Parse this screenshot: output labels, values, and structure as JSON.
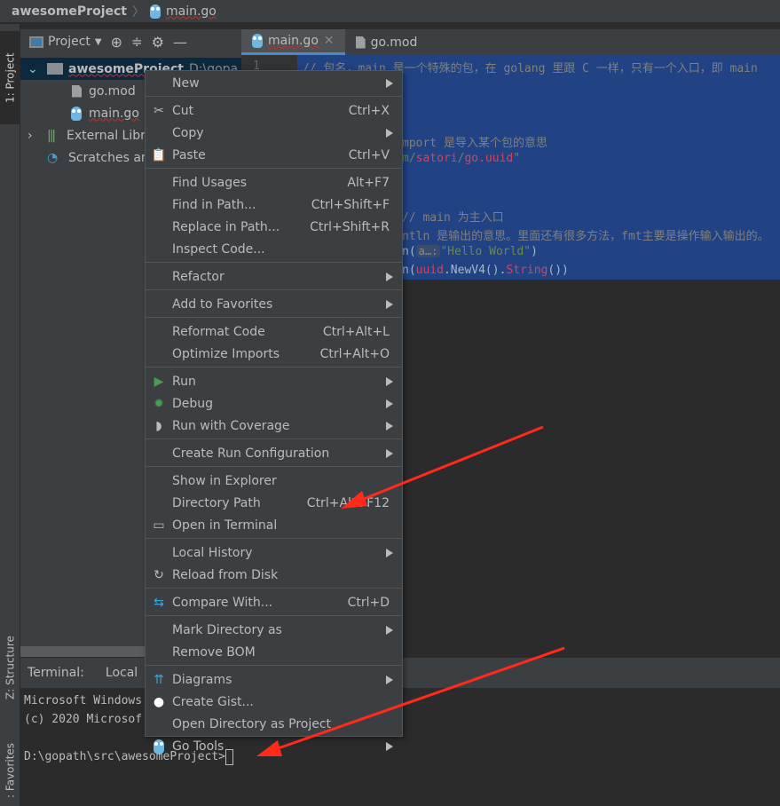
{
  "titlebar": {
    "project": "awesomeProject",
    "file": "main.go"
  },
  "leftstrip": {
    "project_tab": "1: Project",
    "structure_tab": "Z: Structure",
    "favorites_tab": ": Favorites"
  },
  "project_toolbar": {
    "view_label": "Project"
  },
  "tree": [
    {
      "label": "awesomeProject",
      "path": "D:\\gopa",
      "icon": "folder-icon",
      "expanded": true
    },
    {
      "label": "go.mod",
      "icon": "file-icon"
    },
    {
      "label": "main.go",
      "icon": "gopher-icon"
    },
    {
      "label": "External Libr",
      "icon": "library-icon"
    },
    {
      "label": "Scratches ar",
      "icon": "scratches-icon"
    }
  ],
  "editor_tabs": [
    {
      "label": "main.go",
      "active": true
    },
    {
      "label": "go.mod",
      "active": false
    }
  ],
  "code": {
    "line_number": "1",
    "line1": "// 包名，main 是一个特殊的包，在 golang 里跟 C 一样，只有一个入口，即 main",
    "line5": "mport 是导入某个包的意思",
    "line6_a": "m/",
    "line6_b": "satori",
    "line6_c": "/",
    "line6_d": "go.uuid",
    "line6_e": "\"",
    "line9": "// main 为主入口",
    "line10": "ntln 是输出的意思。里面还有很多方法，fmt主要是操作输入输出的。",
    "line11_a": "n(",
    "line11_hint": "a…:",
    "line11_b": "\"Hello World\"",
    "line11_c": ")",
    "line12_a": "n(",
    "line12_b": "uuid",
    "line12_c": ".NewV4().",
    "line12_d": "String",
    "line12_e": "())"
  },
  "terminal": {
    "label": "Terminal:",
    "tab": "Local",
    "lines": [
      "Microsoft Windows",
      "(c) 2020 Microsof",
      "",
      "D:\\gopath\\src\\awesomeProject>"
    ]
  },
  "context_menu": [
    {
      "label": "New",
      "submenu": true
    },
    {
      "sep": true
    },
    {
      "label": "Cut",
      "shortcut": "Ctrl+X",
      "icon": "scissors-icon"
    },
    {
      "label": "Copy",
      "submenu": true
    },
    {
      "label": "Paste",
      "shortcut": "Ctrl+V",
      "icon": "clipboard-icon"
    },
    {
      "sep": true
    },
    {
      "label": "Find Usages",
      "shortcut": "Alt+F7"
    },
    {
      "label": "Find in Path...",
      "shortcut": "Ctrl+Shift+F"
    },
    {
      "label": "Replace in Path...",
      "shortcut": "Ctrl+Shift+R"
    },
    {
      "label": "Inspect Code..."
    },
    {
      "sep": true
    },
    {
      "label": "Refactor",
      "submenu": true
    },
    {
      "sep": true
    },
    {
      "label": "Add to Favorites",
      "submenu": true
    },
    {
      "sep": true
    },
    {
      "label": "Reformat Code",
      "shortcut": "Ctrl+Alt+L"
    },
    {
      "label": "Optimize Imports",
      "shortcut": "Ctrl+Alt+O"
    },
    {
      "sep": true
    },
    {
      "label": "Run",
      "submenu": true,
      "icon": "run-icon"
    },
    {
      "label": "Debug",
      "submenu": true,
      "icon": "debug-icon"
    },
    {
      "label": "Run with Coverage",
      "submenu": true,
      "icon": "coverage-icon"
    },
    {
      "sep": true
    },
    {
      "label": "Create Run Configuration",
      "submenu": true
    },
    {
      "sep": true
    },
    {
      "label": "Show in Explorer"
    },
    {
      "label": "Directory Path",
      "shortcut": "Ctrl+Alt+F12"
    },
    {
      "label": "Open in Terminal",
      "icon": "terminal-icon"
    },
    {
      "sep": true
    },
    {
      "label": "Local History",
      "submenu": true
    },
    {
      "label": "Reload from Disk",
      "icon": "reload-icon"
    },
    {
      "sep": true
    },
    {
      "label": "Compare With...",
      "shortcut": "Ctrl+D",
      "icon": "compare-icon"
    },
    {
      "sep": true
    },
    {
      "label": "Mark Directory as",
      "submenu": true
    },
    {
      "label": "Remove BOM"
    },
    {
      "sep": true
    },
    {
      "label": "Diagrams",
      "submenu": true,
      "icon": "diagrams-icon"
    },
    {
      "label": "Create Gist...",
      "icon": "github-icon"
    },
    {
      "label": "Open Directory as Project"
    },
    {
      "label": "Go Tools",
      "submenu": true,
      "icon": "gopher-icon"
    }
  ],
  "colors": {
    "accent": "#4a88c7",
    "selection": "#214283",
    "annotation_arrow": "#ff2a1a"
  }
}
